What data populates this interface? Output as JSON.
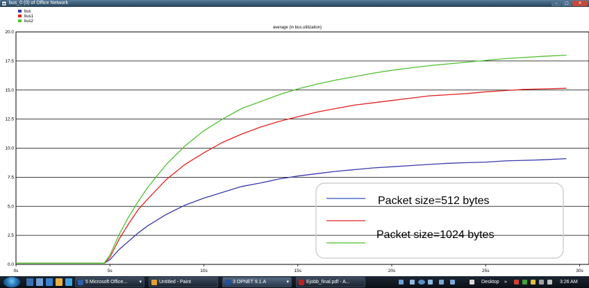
{
  "window": {
    "title": "bus_0 (0) of Office Network",
    "controls": {
      "minimize": "–",
      "maximize": "□",
      "close": "✕"
    }
  },
  "legend_box": {
    "lines": [
      {
        "label": "bus",
        "color": "#3838a8"
      },
      {
        "label": "bus1",
        "color": "#e02020"
      },
      {
        "label": "bus2",
        "color": "#50c030"
      }
    ]
  },
  "annotation": {
    "lines": [
      {
        "color": "#2a52be",
        "text": "Packet size=512 bytes"
      },
      {
        "color": "#e02020",
        "text": ""
      },
      {
        "color": "#50c030",
        "text": "Packet size=1024 bytes"
      }
    ]
  },
  "chart_data": {
    "type": "line",
    "title": "average (in bus.utilization)",
    "xlabel": "",
    "ylabel": "",
    "x_ticks": [
      "0s",
      "5s",
      "10s",
      "15s",
      "20s",
      "25s",
      "30s"
    ],
    "y_ticks": [
      "0.0",
      "2.5",
      "5.0",
      "7.5",
      "10.0",
      "12.5",
      "15.0",
      "17.5",
      "20.0"
    ],
    "xlim": [
      0,
      30.5
    ],
    "ylim": [
      0,
      20
    ],
    "grid": "horizontal",
    "series": [
      {
        "name": "bus",
        "color": "#3838a8",
        "x": [
          0,
          4.7,
          5.0,
          5.5,
          6.0,
          6.5,
          7.0,
          8.0,
          9.0,
          10.0,
          11.0,
          12.0,
          13.0,
          14.0,
          15.0,
          16.0,
          17.0,
          18.0,
          19.0,
          20.0,
          21.0,
          22.0,
          23.0,
          24.0,
          25.0,
          26.0,
          27.0,
          28.0,
          29.3
        ],
        "y": [
          0.1,
          0.1,
          0.4,
          1.3,
          2.0,
          2.7,
          3.3,
          4.3,
          5.1,
          5.7,
          6.2,
          6.7,
          7.0,
          7.35,
          7.6,
          7.8,
          8.0,
          8.15,
          8.3,
          8.4,
          8.5,
          8.6,
          8.7,
          8.75,
          8.8,
          8.9,
          8.95,
          9.0,
          9.1
        ]
      },
      {
        "name": "bus1",
        "color": "#e02020",
        "x": [
          0,
          4.7,
          5.0,
          5.5,
          6.0,
          6.5,
          7.0,
          8.0,
          9.0,
          10.0,
          11.0,
          12.0,
          13.0,
          14.0,
          15.0,
          16.0,
          17.0,
          18.0,
          19.0,
          20.0,
          21.0,
          22.0,
          23.0,
          24.0,
          25.0,
          26.0,
          27.0,
          28.0,
          29.3
        ],
        "y": [
          0.1,
          0.1,
          0.6,
          2.2,
          3.5,
          4.7,
          5.6,
          7.3,
          8.6,
          9.6,
          10.5,
          11.2,
          11.8,
          12.3,
          12.7,
          13.1,
          13.4,
          13.7,
          13.9,
          14.1,
          14.3,
          14.5,
          14.6,
          14.7,
          14.85,
          14.95,
          15.05,
          15.1,
          15.15
        ]
      },
      {
        "name": "bus2",
        "color": "#50c030",
        "x": [
          0,
          4.7,
          5.0,
          5.5,
          6.0,
          6.5,
          7.0,
          8.0,
          9.0,
          10.0,
          11.0,
          12.0,
          13.0,
          14.0,
          15.0,
          16.0,
          17.0,
          18.0,
          19.0,
          20.0,
          21.0,
          22.0,
          23.0,
          24.0,
          25.0,
          26.0,
          27.0,
          28.0,
          29.3
        ],
        "y": [
          0.1,
          0.1,
          0.8,
          2.6,
          4.1,
          5.4,
          6.6,
          8.6,
          10.2,
          11.5,
          12.5,
          13.4,
          14.0,
          14.6,
          15.1,
          15.5,
          15.85,
          16.15,
          16.45,
          16.7,
          16.9,
          17.1,
          17.25,
          17.4,
          17.55,
          17.7,
          17.8,
          17.9,
          18.0
        ]
      }
    ]
  },
  "taskbar": {
    "buttons": [
      {
        "label": "5 Microsoft Office...",
        "color": "#2f5da8",
        "active": false,
        "arrow": "▾"
      },
      {
        "label": "Untitled - Paint",
        "color": "#e0a030",
        "active": false
      },
      {
        "label": "3 OPNET 9.1.A",
        "color": "#2050a0",
        "active": true,
        "arrow": "▾"
      },
      {
        "label": "Ejobb_final.pdf - A...",
        "color": "#c02020",
        "active": false
      }
    ],
    "desktop_label": "Desktop",
    "desktop_arrow": "»",
    "clock": "3:26 AM"
  }
}
